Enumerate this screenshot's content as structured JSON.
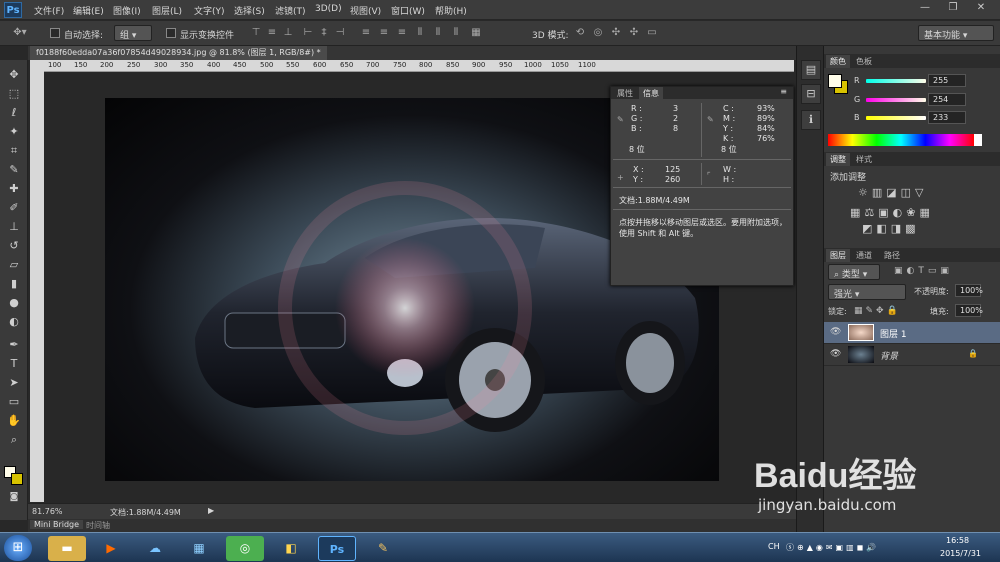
{
  "app": {
    "logo": "Ps"
  },
  "menu": [
    "文件(F)",
    "编辑(E)",
    "图像(I)",
    "图层(L)",
    "文字(Y)",
    "选择(S)",
    "滤镜(T)",
    "3D(D)",
    "视图(V)",
    "窗口(W)",
    "帮助(H)"
  ],
  "window_controls": {
    "minimize": "—",
    "restore": "❐",
    "close": "✕"
  },
  "options": {
    "auto_select_label": "自动选择:",
    "auto_select_value": "组",
    "show_transform_label": "显示变换控件",
    "mode_3d_label": "3D 模式:",
    "workspace": "基本功能"
  },
  "document": {
    "tab_title": "f0188f60edda07a36f07854d49028934.jpg @ 81.8% (图层 1, RGB/8#) *",
    "zoom": "81.76%",
    "status": "文档:1.88M/4.49M"
  },
  "ruler": {
    "top": [
      "100",
      "150",
      "200",
      "250",
      "300",
      "350",
      "400",
      "450",
      "500",
      "550",
      "600",
      "650",
      "700",
      "750",
      "800",
      "850",
      "900",
      "950",
      "1000",
      "1050",
      "1100"
    ]
  },
  "bottom_tabs": [
    "Mini Bridge",
    "时间轴"
  ],
  "info_panel": {
    "tabs": [
      "属性",
      "信息"
    ],
    "rgb": {
      "R": "3",
      "G": "2",
      "B": "8"
    },
    "cmyk": {
      "C": "93%",
      "M": "89%",
      "Y": "84%",
      "K": "76%"
    },
    "bits_left": "8 位",
    "bits_right": "8 位",
    "x": "125",
    "y": "260",
    "w": "",
    "h": "",
    "doc": "文档:1.88M/4.49M",
    "hint": "点按并拖移以移动图层或选区。要用附加选项，使用 Shift 和 Alt 键。"
  },
  "color_panel": {
    "tabs": [
      "颜色",
      "色板"
    ],
    "R": "255",
    "G": "254",
    "B": "233"
  },
  "adjust_panel": {
    "tabs": [
      "调整",
      "样式"
    ],
    "title": "添加调整"
  },
  "layers_panel": {
    "tabs": [
      "图层",
      "通道",
      "路径"
    ],
    "filter": "类型",
    "blend_mode": "强光",
    "opacity_label": "不透明度:",
    "opacity": "100%",
    "lock_label": "锁定:",
    "fill_label": "填充:",
    "fill": "100%",
    "layers": [
      {
        "name": "图层 1",
        "selected": true
      },
      {
        "name": "背景",
        "selected": false
      }
    ]
  },
  "taskbar": {
    "time": "16:58",
    "date": "2015/7/31",
    "lang": "CH"
  },
  "watermark": {
    "brand": "Baidu经验",
    "url": "jingyan.baidu.com"
  },
  "colors": {
    "accent": "#2b6cb0",
    "panel": "#383838",
    "foreground": "#fffde9",
    "background": "#d8c300"
  }
}
